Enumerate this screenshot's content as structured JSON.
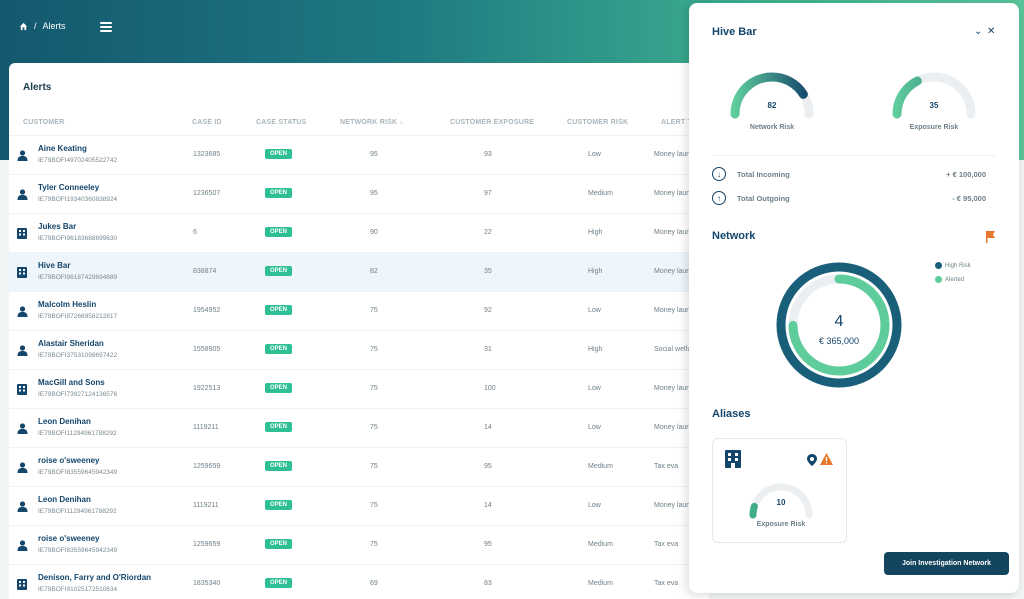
{
  "breadcrumb": {
    "section": "Alerts"
  },
  "alerts": {
    "title": "Alerts",
    "columns": [
      "CUSTOMER",
      "CASE ID",
      "CASE STATUS",
      "NETWORK RISK",
      "CUSTOMER EXPOSURE",
      "CUSTOMER RISK",
      "ALERT T"
    ],
    "rows": [
      {
        "type": "person",
        "name": "Aine Keating",
        "account": "IE79BOFI49702405522742",
        "case_id": "1323685",
        "status": "OPEN",
        "network_risk": "95",
        "exposure": "93",
        "risk": "Low",
        "alert": "Money laun"
      },
      {
        "type": "person",
        "name": "Tyler Conneeley",
        "account": "IE79BOFI19340360838924",
        "case_id": "1236507",
        "status": "OPEN",
        "network_risk": "95",
        "exposure": "97",
        "risk": "Medium",
        "alert": "Money laun"
      },
      {
        "type": "business",
        "name": "Jukes Bar",
        "account": "IE79BOFI96183688699630",
        "case_id": "6",
        "status": "OPEN",
        "network_risk": "90",
        "exposure": "22",
        "risk": "High",
        "alert": "Money laun"
      },
      {
        "type": "business",
        "name": "Hive Bar",
        "account": "IE79BOFI96187429694889",
        "case_id": "838874",
        "status": "OPEN",
        "network_risk": "82",
        "exposure": "35",
        "risk": "High",
        "alert": "Money laun",
        "selected": true
      },
      {
        "type": "person",
        "name": "Malcolm Heslin",
        "account": "IE79BOFI87266958212817",
        "case_id": "1954952",
        "status": "OPEN",
        "network_risk": "75",
        "exposure": "92",
        "risk": "Low",
        "alert": "Money laun"
      },
      {
        "type": "person",
        "name": "Alastair Sheridan",
        "account": "IE79BOFI37531098697422",
        "case_id": "1558905",
        "status": "OPEN",
        "network_risk": "75",
        "exposure": "31",
        "risk": "High",
        "alert": "Social welfa"
      },
      {
        "type": "business",
        "name": "MacGill and Sons",
        "account": "IE79BOFI73927124136576",
        "case_id": "1922513",
        "status": "OPEN",
        "network_risk": "75",
        "exposure": "100",
        "risk": "Low",
        "alert": "Money laun"
      },
      {
        "type": "person",
        "name": "Leon Denihan",
        "account": "IE79BOFI11294961788292",
        "case_id": "1119211",
        "status": "OPEN",
        "network_risk": "75",
        "exposure": "14",
        "risk": "Low",
        "alert": "Money laun"
      },
      {
        "type": "person",
        "name": "roise o'sweeney",
        "account": "IE79BOFI83559645942349",
        "case_id": "1259659",
        "status": "OPEN",
        "network_risk": "75",
        "exposure": "95",
        "risk": "Medium",
        "alert": "Tax eva"
      },
      {
        "type": "person",
        "name": "Leon Denihan",
        "account": "IE79BOFI11294961788292",
        "case_id": "1119211",
        "status": "OPEN",
        "network_risk": "75",
        "exposure": "14",
        "risk": "Low",
        "alert": "Money laun"
      },
      {
        "type": "person",
        "name": "roise o'sweeney",
        "account": "IE79BOFI83559645942349",
        "case_id": "1259659",
        "status": "OPEN",
        "network_risk": "75",
        "exposure": "95",
        "risk": "Medium",
        "alert": "Tax eva"
      },
      {
        "type": "business",
        "name": "Denison, Farry and O'Riordan",
        "account": "IE79BOFI91025172510634",
        "case_id": "1835340",
        "status": "OPEN",
        "network_risk": "69",
        "exposure": "83",
        "risk": "Medium",
        "alert": "Tax eva"
      }
    ]
  },
  "panel": {
    "title": "Hive Bar",
    "network_risk": {
      "value": 82,
      "label": "Network Risk"
    },
    "exposure_risk": {
      "value": 35,
      "label": "Exposure Risk"
    },
    "total_incoming": {
      "label": "Total Incoming",
      "value": "+ € 100,000"
    },
    "total_outgoing": {
      "label": "Total Outgoing",
      "value": "- € 95,000"
    },
    "network": {
      "title": "Network",
      "count": "4",
      "amount": "€ 365,000",
      "legend": [
        {
          "label": "High Risk",
          "color": "#1a5f7a"
        },
        {
          "label": "Alerted",
          "color": "#5fcc9c"
        }
      ]
    },
    "aliases": {
      "title": "Aliases",
      "exposure": {
        "value": 10,
        "label": "Exposure Risk"
      }
    },
    "join_button": "Join Investigation Network"
  },
  "colors": {
    "brand_dark": "#14455f",
    "accent_green": "#2fbf94",
    "warning": "#e8762b"
  }
}
